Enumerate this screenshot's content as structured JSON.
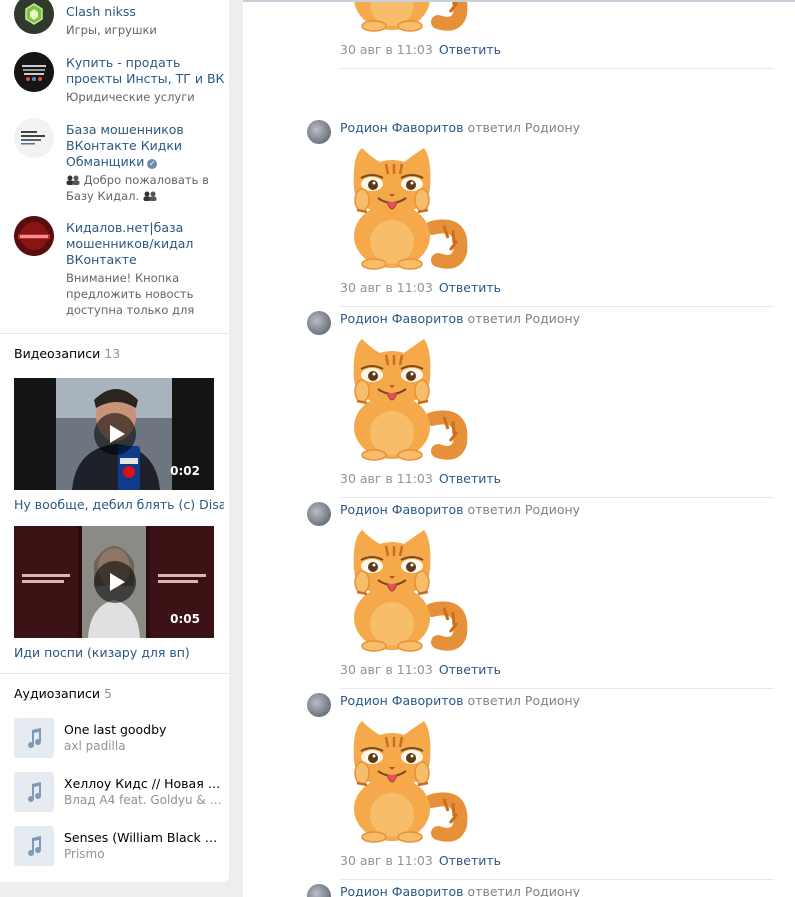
{
  "groups": [
    {
      "name": "Clash nikss",
      "desc": "Игры, игрушки"
    },
    {
      "name": "Купить - продать проекты Инсты, ТГ и ВК",
      "desc": "Юридические услуги"
    },
    {
      "name": "База мошенников ВКонтакте Кидки Обманщики",
      "desc_before": "Добро пожаловать в Базу Кидал.",
      "desc_after": ""
    },
    {
      "name": "Кидалов.нет|база мошенников/кидал ВКонтакте",
      "desc": "Внимание! Кнопка предложить новость доступна только для"
    }
  ],
  "videos": {
    "title": "Видеозаписи",
    "count": "13",
    "items": [
      {
        "title": "Ну вообще, дебил блять (с) Disa",
        "duration": "0:02"
      },
      {
        "title": "Иди поспи (кизару для вп)",
        "duration": "0:05"
      }
    ]
  },
  "audios": {
    "title": "Аудиозаписи",
    "count": "5",
    "items": [
      {
        "title": "One last goodby",
        "artist": "axl padilla"
      },
      {
        "title": "Хеллоу Кидс // Новая Лат...",
        "artist": "Влад А4 feat. Goldyu & JS..."
      },
      {
        "title": "Senses (William Black Re...",
        "artist": "Prismo"
      }
    ]
  },
  "replies": {
    "author": "Родион Фаворитов",
    "action": "ответил",
    "reply_to": "Родиону",
    "date": "30 авг в 11:03",
    "answer_label": "Ответить"
  },
  "colors": {
    "link": "#2a5885",
    "muted": "#939393",
    "sticker_body": "#f5a94a"
  }
}
